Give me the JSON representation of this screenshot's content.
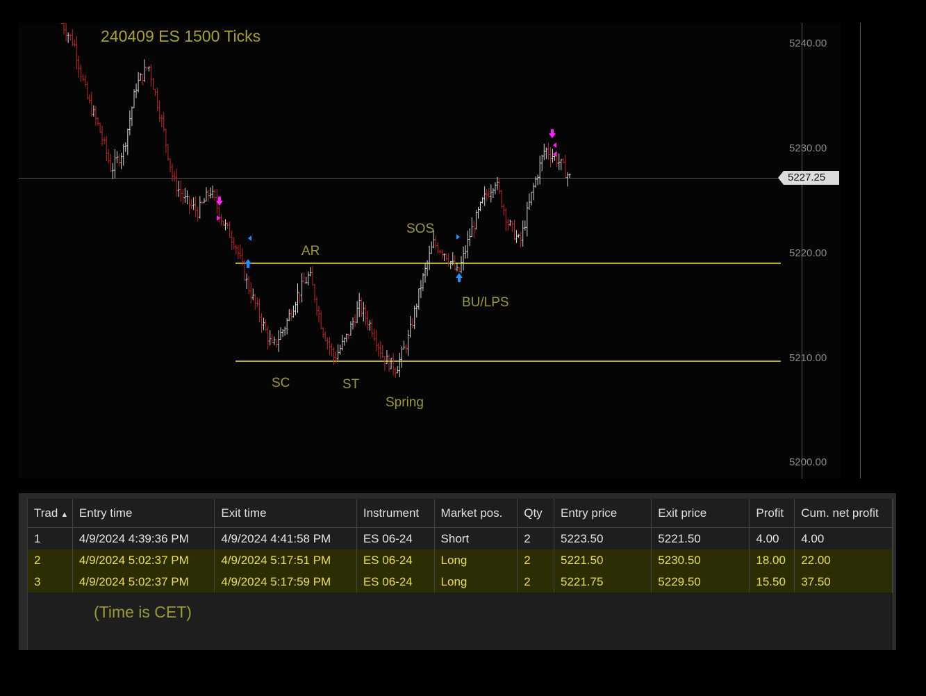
{
  "chart": {
    "title": "240409 ES 1500 Ticks",
    "last_price": "5227.25",
    "price_ticks": [
      "5240.00",
      "5230.00",
      "5220.00",
      "5210.00",
      "5200.00"
    ],
    "annotations": {
      "ar": "AR",
      "sos": "SOS",
      "bu_lps": "BU/LPS",
      "sc": "SC",
      "st": "ST",
      "spring": "Spring"
    },
    "colors": {
      "up_bar": "#d8d8d8",
      "down_bar": "#c0262b",
      "level_line": "#b5b12a",
      "short_marker": "#ff1fff",
      "long_marker": "#1e90ff"
    }
  },
  "chart_data": {
    "type": "ohlc",
    "title": "240409 ES 1500 Ticks",
    "y_ticks": [
      5240,
      5230,
      5220,
      5210,
      5200
    ],
    "ylim": [
      5198.8,
      5242.1
    ],
    "last_price": 5227.25,
    "levels": [
      5219.0,
      5209.75
    ],
    "close_path": [
      5242,
      5240,
      5235,
      5232,
      5228,
      5230,
      5236,
      5238,
      5233,
      5227,
      5225,
      5224,
      5226,
      5223,
      5221,
      5217,
      5214,
      5211,
      5213,
      5216,
      5218,
      5213,
      5210,
      5212,
      5215,
      5213,
      5210,
      5209,
      5212,
      5217,
      5221,
      5220,
      5218,
      5222,
      5225,
      5227,
      5223,
      5221,
      5226,
      5230,
      5229,
      5227.25
    ]
  },
  "trades": {
    "columns": [
      "Trade",
      "Entry time",
      "Exit time",
      "Instrument",
      "Market pos.",
      "Qty",
      "Entry price",
      "Exit price",
      "Profit",
      "Cum. net profit"
    ],
    "first_column_visible": "Trad",
    "rows": [
      {
        "num": "1",
        "entry_time": "4/9/2024 4:39:36 PM",
        "exit_time": "4/9/2024 4:41:58 PM",
        "instrument": "ES 06-24",
        "pos": "Short",
        "qty": "2",
        "entry_price": "5223.50",
        "exit_price": "5221.50",
        "profit": "4.00",
        "cum": "4.00"
      },
      {
        "num": "2",
        "entry_time": "4/9/2024 5:02:37 PM",
        "exit_time": "4/9/2024 5:17:51 PM",
        "instrument": "ES 06-24",
        "pos": "Long",
        "qty": "2",
        "entry_price": "5221.50",
        "exit_price": "5230.50",
        "profit": "18.00",
        "cum": "22.00"
      },
      {
        "num": "3",
        "entry_time": "4/9/2024 5:02:37 PM",
        "exit_time": "4/9/2024 5:17:59 PM",
        "instrument": "ES 06-24",
        "pos": "Long",
        "qty": "2",
        "entry_price": "5221.75",
        "exit_price": "5229.50",
        "profit": "15.50",
        "cum": "37.50"
      }
    ],
    "note": "(Time is CET)"
  }
}
